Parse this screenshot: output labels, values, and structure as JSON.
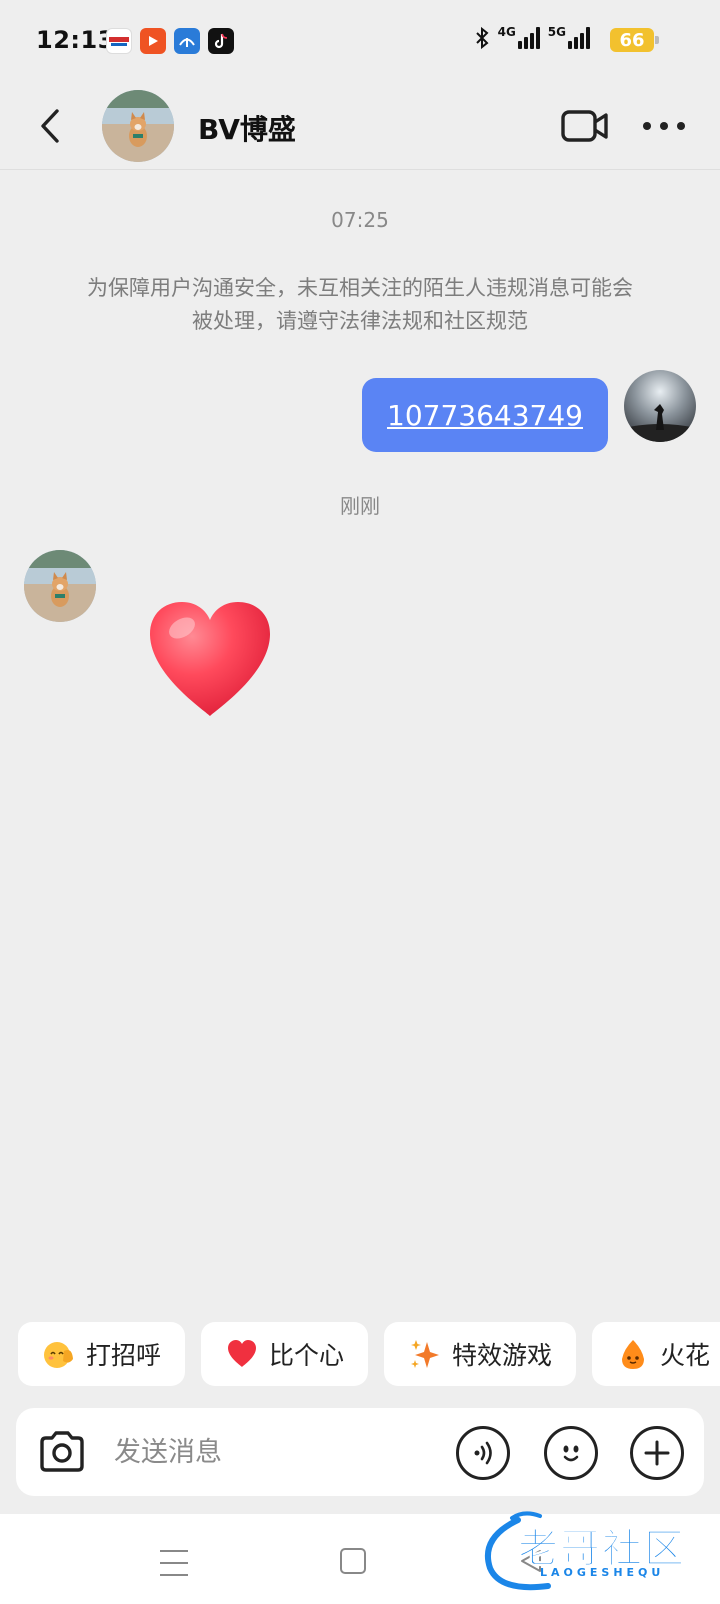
{
  "status_bar": {
    "time": "12:13",
    "network_1": "4G",
    "network_2": "5G",
    "battery": "66",
    "apps": [
      "hikvision-app-icon",
      "video-app-icon",
      "navigation-app-icon",
      "tiktok-app-icon"
    ],
    "battery_color": "#f2c12e"
  },
  "header": {
    "contact_name": "BV博盛"
  },
  "messages": {
    "timestamp_1": "07:25",
    "notice": "为保障用户沟通安全，未互相关注的陌生人违规消息可能会被处理，请遵守法律法规和社区规范",
    "outgoing_text": "10773643749",
    "timestamp_2": "刚刚",
    "incoming_sticker": "red-heart"
  },
  "quick_replies": [
    {
      "label": "打招呼",
      "icon": "wave-emoji-icon"
    },
    {
      "label": "比个心",
      "icon": "heart-emoji-icon"
    },
    {
      "label": "特效游戏",
      "icon": "sparkle-icon"
    },
    {
      "label": "火花",
      "icon": "spark-mascot-icon"
    }
  ],
  "input": {
    "placeholder": "发送消息"
  },
  "watermark": {
    "text": "老哥社区",
    "sub": "LAOGESHEQU"
  },
  "colors": {
    "accent": "#5a84f4",
    "background": "#eeeeee"
  }
}
